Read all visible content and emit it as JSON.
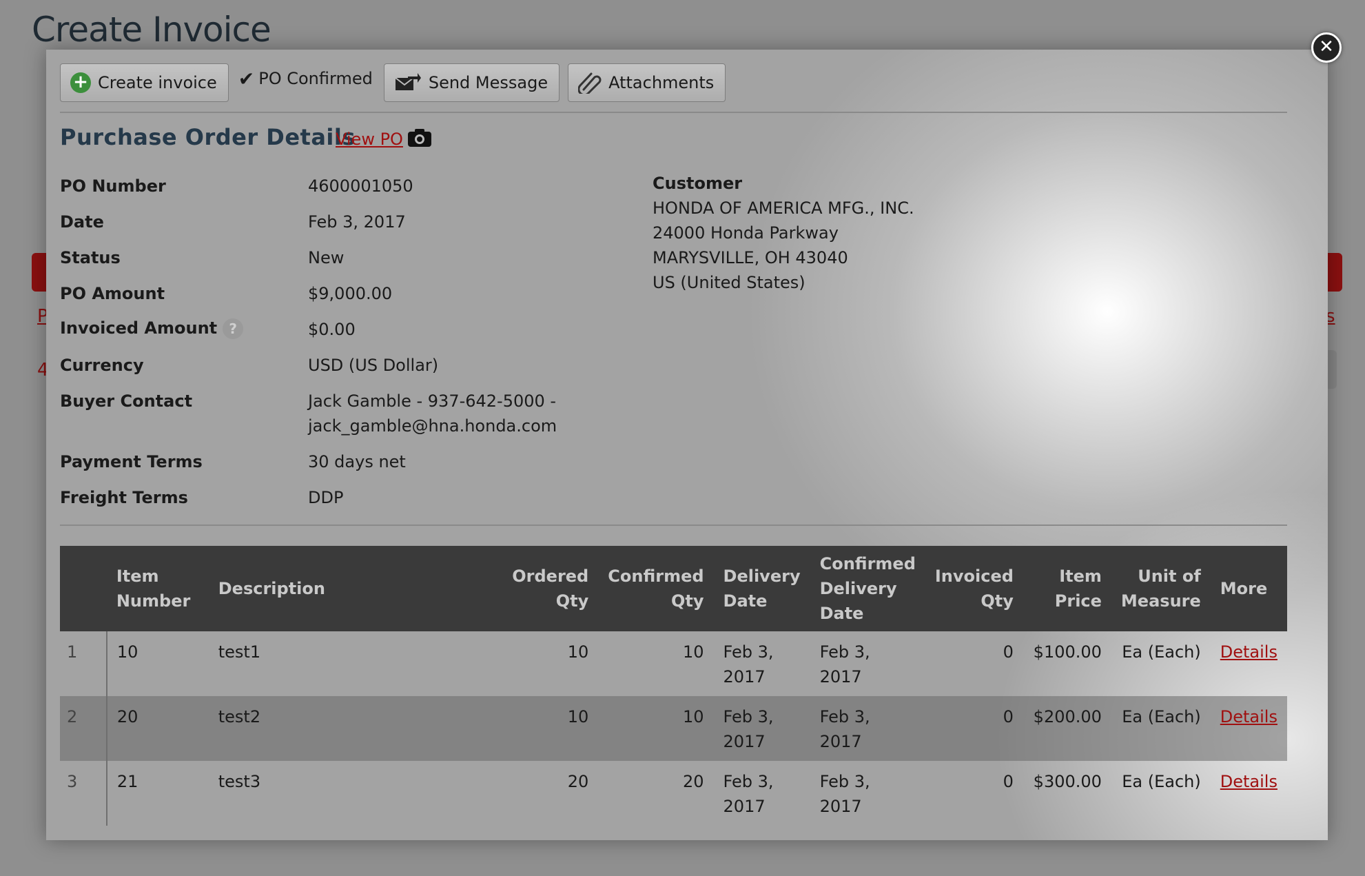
{
  "background": {
    "title": "Create Invoice",
    "fragment_left": "P",
    "fragment_right": "s",
    "fragment_left2": "4"
  },
  "toolbar": {
    "create_invoice": "Create invoice",
    "po_confirmed": "PO Confirmed",
    "send_message": "Send Message",
    "attachments": "Attachments"
  },
  "details": {
    "title": "Purchase Order Details",
    "view_po": "View PO",
    "fields": [
      {
        "label": "PO Number",
        "value": "4600001050"
      },
      {
        "label": "Date",
        "value": "Feb 3, 2017"
      },
      {
        "label": "Status",
        "value": "New"
      },
      {
        "label": "PO Amount",
        "value": "$9,000.00"
      },
      {
        "label": "Invoiced Amount",
        "value": "$0.00"
      },
      {
        "label": "Currency",
        "value": "USD (US Dollar)"
      },
      {
        "label": "Buyer Contact",
        "value_line1": "Jack Gamble - 937-642-5000 -",
        "value_line2": "jack_gamble@hna.honda.com"
      },
      {
        "label": "Payment Terms",
        "value": "30 days net"
      },
      {
        "label": "Freight Terms",
        "value": "DDP"
      }
    ],
    "customer": {
      "label": "Customer",
      "name": "HONDA OF AMERICA MFG., INC.",
      "address1": "24000 Honda Parkway",
      "address2": "MARYSVILLE, OH 43040",
      "country": "US (United States)"
    }
  },
  "table": {
    "headers": {
      "item_number": [
        "Item",
        "Number"
      ],
      "description": "Description",
      "ordered_qty": [
        "Ordered",
        "Qty"
      ],
      "confirmed_qty": [
        "Confirmed",
        "Qty"
      ],
      "delivery_date": [
        "Delivery",
        "Date"
      ],
      "confirmed_delivery_date": [
        "Confirmed",
        "Delivery",
        "Date"
      ],
      "invoiced_qty": [
        "Invoiced",
        "Qty"
      ],
      "item_price": [
        "Item",
        "Price"
      ],
      "unit_of_measure": [
        "Unit of",
        "Measure"
      ],
      "more": "More"
    },
    "rows": [
      {
        "idx": "1",
        "item": "10",
        "desc": "test1",
        "ordered": "10",
        "confirmed": "10",
        "delivery": [
          "Feb 3,",
          "2017"
        ],
        "conf_delivery": [
          "Feb 3,",
          "2017"
        ],
        "invoiced": "0",
        "price": "$100.00",
        "uom": "Ea (Each)",
        "more": "Details"
      },
      {
        "idx": "2",
        "item": "20",
        "desc": "test2",
        "ordered": "10",
        "confirmed": "10",
        "delivery": [
          "Feb 3,",
          "2017"
        ],
        "conf_delivery": [
          "Feb 3,",
          "2017"
        ],
        "invoiced": "0",
        "price": "$200.00",
        "uom": "Ea (Each)",
        "more": "Details"
      },
      {
        "idx": "3",
        "item": "21",
        "desc": "test3",
        "ordered": "20",
        "confirmed": "20",
        "delivery": [
          "Feb 3,",
          "2017"
        ],
        "conf_delivery": [
          "Feb 3,",
          "2017"
        ],
        "invoiced": "0",
        "price": "$300.00",
        "uom": "Ea (Each)",
        "more": "Details"
      }
    ]
  },
  "icons": {
    "close": "close-icon",
    "create": "plus-circle-icon",
    "confirmed": "checkmark-icon",
    "send": "envelope-arrow-icon",
    "attach": "paperclip-icon",
    "camera": "camera-icon",
    "help": "help-icon"
  }
}
